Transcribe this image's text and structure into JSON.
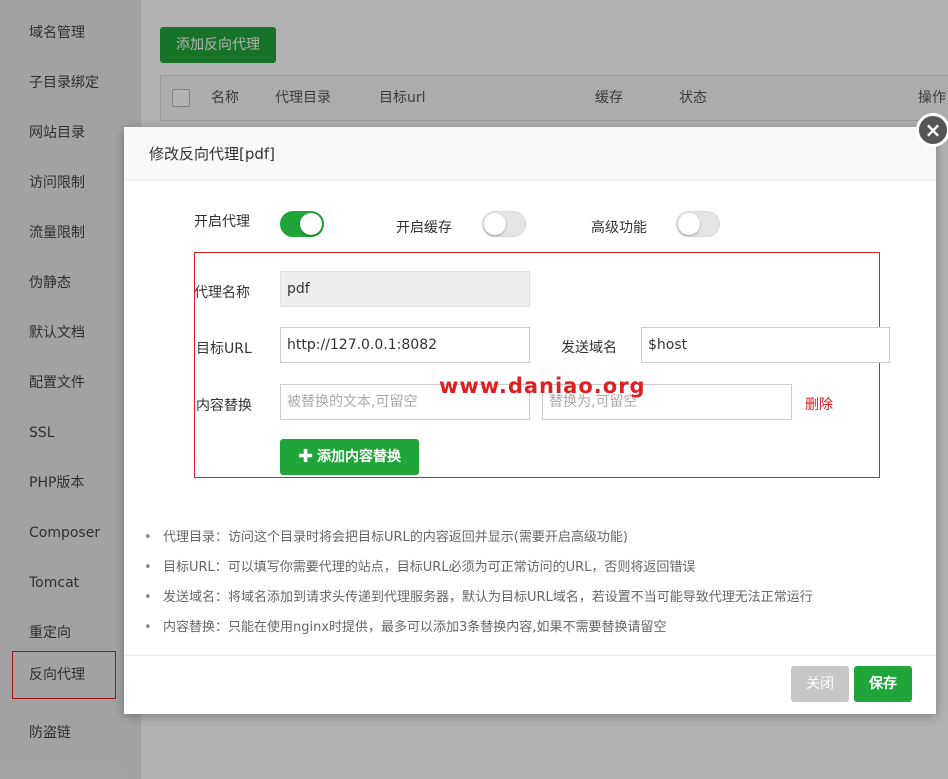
{
  "sidebar": {
    "items": [
      {
        "label": "域名管理"
      },
      {
        "label": "子目录绑定"
      },
      {
        "label": "网站目录"
      },
      {
        "label": "访问限制"
      },
      {
        "label": "流量限制"
      },
      {
        "label": "伪静态"
      },
      {
        "label": "默认文档"
      },
      {
        "label": "配置文件"
      },
      {
        "label": "SSL"
      },
      {
        "label": "PHP版本"
      },
      {
        "label": "Composer"
      },
      {
        "label": "Tomcat"
      },
      {
        "label": "重定向"
      },
      {
        "label": "反向代理"
      },
      {
        "label": "防盗链"
      }
    ]
  },
  "main": {
    "add_button": "添加反向代理",
    "table_headers": [
      "名称",
      "代理目录",
      "目标url",
      "缓存",
      "状态",
      "操作"
    ]
  },
  "dialog": {
    "title": "修改反向代理[pdf]",
    "close_icon": "×",
    "toggles": {
      "proxy_label": "开启代理",
      "proxy_on": true,
      "cache_label": "开启缓存",
      "cache_on": false,
      "advanced_label": "高级功能",
      "advanced_on": false
    },
    "form": {
      "name_label": "代理名称",
      "name_value": "pdf",
      "url_label": "目标URL",
      "url_value": "http://127.0.0.1:8082",
      "domain_label": "发送域名",
      "domain_value": "$host",
      "replace_label": "内容替换",
      "replace_from_placeholder": "被替换的文本,可留空",
      "replace_to_placeholder": "替换为,可留空",
      "delete_label": "删除",
      "add_replace_button": "添加内容替换",
      "add_icon": "plus-icon"
    },
    "watermark": "www.daniao.org",
    "tips": [
      "代理目录：访问这个目录时将会把目标URL的内容返回并显示(需要开启高级功能)",
      "目标URL：可以填写你需要代理的站点，目标URL必须为可正常访问的URL，否则将返回错误",
      "发送域名：将域名添加到请求头传递到代理服务器，默认为目标URL域名，若设置不当可能导致代理无法正常运行",
      "内容替换：只能在使用nginx时提供，最多可以添加3条替换内容,如果不需要替换请留空"
    ],
    "footer": {
      "close_label": "关闭",
      "save_label": "保存"
    }
  },
  "colors": {
    "accent": "#20a53a",
    "highlight": "#e02020"
  }
}
